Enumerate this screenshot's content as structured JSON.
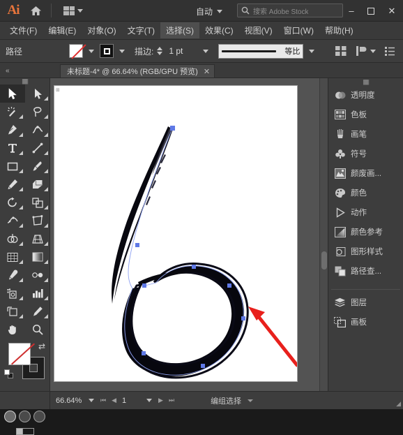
{
  "app": {
    "logo": "Ai",
    "home_icon": "home-icon",
    "arrange_icon": "arrange-documents-icon",
    "auto_label": "自动",
    "search_placeholder": "搜索 Adobe Stock",
    "search_icon": "search-stock-icon",
    "window_buttons": {
      "minimize": "–",
      "maximize": "☐",
      "close": "✕"
    }
  },
  "menubar": {
    "items": [
      {
        "label": "文件(F)",
        "selected": false
      },
      {
        "label": "编辑(E)",
        "selected": false
      },
      {
        "label": "对象(O)",
        "selected": false
      },
      {
        "label": "文字(T)",
        "selected": false
      },
      {
        "label": "选择(S)",
        "selected": true
      },
      {
        "label": "效果(C)",
        "selected": false
      },
      {
        "label": "视图(V)",
        "selected": false
      },
      {
        "label": "窗口(W)",
        "selected": false
      },
      {
        "label": "帮助(H)",
        "selected": false
      }
    ]
  },
  "controlbar": {
    "object_type": "路径",
    "fill_swatch": "none-fill-swatch",
    "stroke_swatch": "black-stroke-swatch",
    "stroke_label": "描边:",
    "stroke_weight": "1 pt",
    "profile_label": "等比",
    "align_icon": "align-icon",
    "transform_icon": "transform-icon",
    "options_icon": "more-options-icon"
  },
  "tabbar": {
    "collapse_icon": "collapse-panel-chevrons",
    "document_title": "未标题-4* @ 66.64% (RGB/GPU 预览)",
    "close_label": "✕"
  },
  "toolbox": {
    "handle": "panel-drag-handle",
    "tools": [
      {
        "name": "selection-tool",
        "active": true
      },
      {
        "name": "direct-selection-tool",
        "active": false
      },
      {
        "name": "magic-wand-tool",
        "active": false
      },
      {
        "name": "lasso-tool",
        "active": false
      },
      {
        "name": "pen-tool",
        "active": false
      },
      {
        "name": "curvature-tool",
        "active": false
      },
      {
        "name": "type-tool",
        "active": false
      },
      {
        "name": "line-segment-tool",
        "active": false
      },
      {
        "name": "rectangle-tool",
        "active": false
      },
      {
        "name": "paintbrush-tool",
        "active": false
      },
      {
        "name": "shaper-pencil-tool",
        "active": false
      },
      {
        "name": "eraser-tool",
        "active": false
      },
      {
        "name": "rotate-tool",
        "active": false
      },
      {
        "name": "scale-tool",
        "active": false
      },
      {
        "name": "width-tool",
        "active": false
      },
      {
        "name": "free-transform-tool",
        "active": false
      },
      {
        "name": "shape-builder-tool",
        "active": false
      },
      {
        "name": "perspective-grid-tool",
        "active": false
      },
      {
        "name": "mesh-tool",
        "active": false
      },
      {
        "name": "gradient-tool",
        "active": false
      },
      {
        "name": "eyedropper-tool",
        "active": false
      },
      {
        "name": "blend-tool",
        "active": false
      },
      {
        "name": "symbol-sprayer-tool",
        "active": false
      },
      {
        "name": "column-graph-tool",
        "active": false
      },
      {
        "name": "artboard-tool",
        "active": false
      },
      {
        "name": "slice-tool",
        "active": false
      },
      {
        "name": "hand-tool",
        "active": false
      },
      {
        "name": "zoom-tool",
        "active": false
      }
    ],
    "fill_swatch": "fill-none-swatch",
    "stroke_swatch": "stroke-black-swatch",
    "swap_icon": "swap-fill-stroke-icon",
    "default_icon": "default-fill-stroke-icon",
    "color_modes": [
      "color-swatch",
      "gradient-swatch",
      "none-swatch"
    ],
    "draw_modes": [
      "draw-normal",
      "draw-behind",
      "draw-inside"
    ],
    "screen_mode": "change-screen-mode"
  },
  "canvas": {
    "artboard_background": "#ffffff",
    "artwork_name": "brush-stroke-digit-six",
    "artwork_color": "#080810",
    "path_color": "#7a8cf0",
    "anchor_color": "#6b82e8",
    "annotation_arrow": "red-arrow-annotation",
    "annotation_color": "#e8201c",
    "scrollbar": "vertical-scrollbar"
  },
  "rightpanel": {
    "handle": "panel-drag-handle",
    "groups": [
      [
        {
          "label": "透明度",
          "icon": "transparency-icon"
        },
        {
          "label": "色板",
          "icon": "swatches-icon"
        },
        {
          "label": "画笔",
          "icon": "brushes-icon"
        },
        {
          "label": "符号",
          "icon": "symbols-icon"
        },
        {
          "label": "颜废画...",
          "icon": "image-trace-icon"
        },
        {
          "label": "颜色",
          "icon": "color-icon"
        },
        {
          "label": "动作",
          "icon": "actions-icon"
        },
        {
          "label": "颜色参考",
          "icon": "color-guide-icon"
        },
        {
          "label": "图形样式",
          "icon": "graphic-styles-icon"
        },
        {
          "label": "路径查...",
          "icon": "pathfinder-icon"
        }
      ],
      [
        {
          "label": "图层",
          "icon": "layers-icon"
        },
        {
          "label": "画板",
          "icon": "artboards-icon"
        }
      ]
    ]
  },
  "statusbar": {
    "zoom": "66.64%",
    "first_icon": "first-artboard-icon",
    "prev_icon": "prev-artboard-icon",
    "page": "1",
    "next_icon": "next-artboard-icon",
    "last_icon": "last-artboard-icon",
    "status_text": "编组选择",
    "resize_grip": "resize-grip"
  }
}
